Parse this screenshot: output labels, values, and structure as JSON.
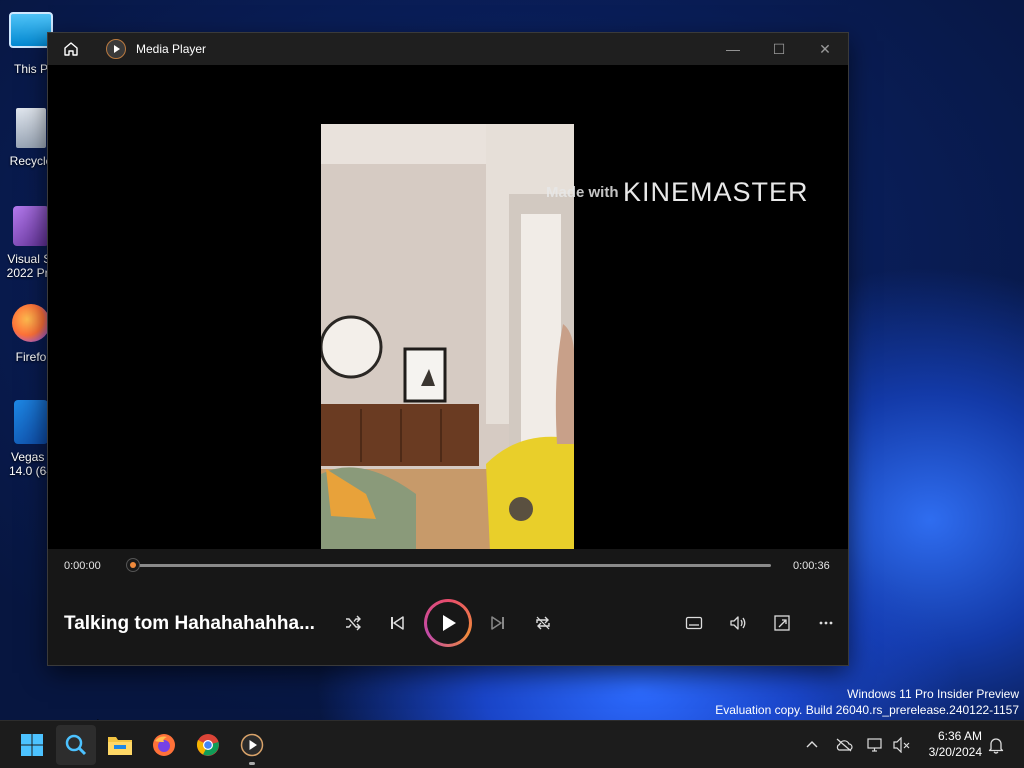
{
  "desktop": {
    "icons": [
      {
        "label_line1": "This P",
        "label_line2": ""
      },
      {
        "label_line1": "Recycle",
        "label_line2": ""
      },
      {
        "label_line1": "Visual St",
        "label_line2": "2022 Pre"
      },
      {
        "label_line1": "Firefo",
        "label_line2": ""
      },
      {
        "label_line1": "Vegas I",
        "label_line2": "14.0 (64"
      }
    ],
    "watermark_line1": "Windows 11 Pro Insider Preview",
    "watermark_line2": "Evaluation copy. Build 26040.rs_prerelease.240122-1157"
  },
  "window": {
    "title": "Media Player",
    "minimize_glyph": "—",
    "maximize_glyph": "☐",
    "close_glyph": "✕"
  },
  "video": {
    "overlay_prefix": "Made with",
    "overlay_brand": "KINEMASTER"
  },
  "player": {
    "current_time": "0:00:00",
    "total_time": "0:00:36",
    "progress": 0.0,
    "track_title": "Talking tom Hahahahahha...",
    "accent_colors": [
      "#e84c6c",
      "#f08a3c",
      "#c24ba8"
    ]
  },
  "taskbar": {
    "apps": [
      "windows-start",
      "search",
      "file-explorer",
      "firefox",
      "chrome",
      "media-player"
    ],
    "clock_time": "6:36 AM",
    "clock_date": "3/20/2024"
  }
}
